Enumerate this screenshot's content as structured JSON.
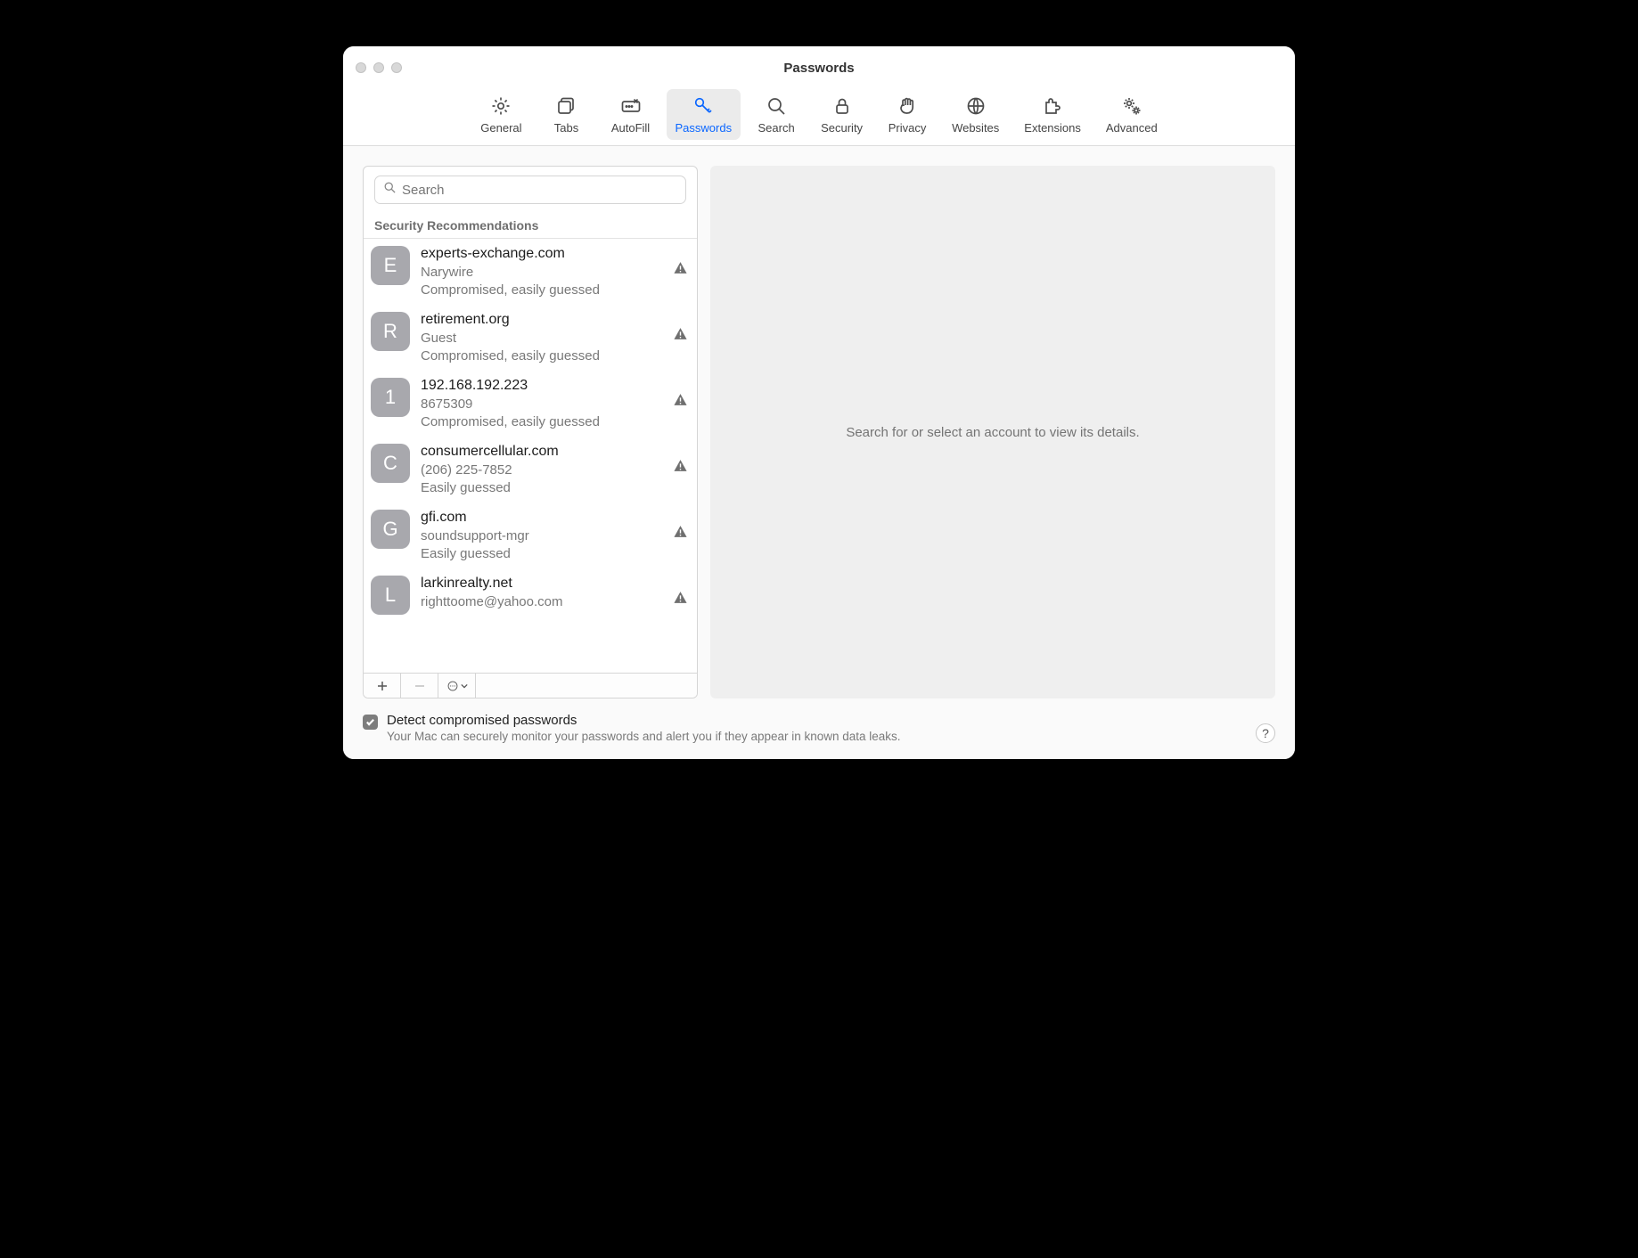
{
  "title": "Passwords",
  "toolbar": [
    {
      "id": "general",
      "label": "General",
      "icon": "gear"
    },
    {
      "id": "tabs",
      "label": "Tabs",
      "icon": "tabs"
    },
    {
      "id": "autofill",
      "label": "AutoFill",
      "icon": "autofill"
    },
    {
      "id": "passwords",
      "label": "Passwords",
      "icon": "key",
      "active": true
    },
    {
      "id": "search",
      "label": "Search",
      "icon": "search"
    },
    {
      "id": "security",
      "label": "Security",
      "icon": "lock"
    },
    {
      "id": "privacy",
      "label": "Privacy",
      "icon": "hand"
    },
    {
      "id": "websites",
      "label": "Websites",
      "icon": "globe"
    },
    {
      "id": "extensions",
      "label": "Extensions",
      "icon": "puzzle"
    },
    {
      "id": "advanced",
      "label": "Advanced",
      "icon": "gears"
    }
  ],
  "search": {
    "placeholder": "Search"
  },
  "list": {
    "section_header": "Security Recommendations",
    "items": [
      {
        "letter": "E",
        "site": "experts-exchange.com",
        "user": "Narywire",
        "status": "Compromised, easily guessed"
      },
      {
        "letter": "R",
        "site": "retirement.org",
        "user": "Guest",
        "status": "Compromised, easily guessed"
      },
      {
        "letter": "1",
        "site": "192.168.192.223",
        "user": "8675309",
        "status": "Compromised, easily guessed"
      },
      {
        "letter": "C",
        "site": "consumercellular.com",
        "user": "(206) 225-7852",
        "status": "Easily guessed"
      },
      {
        "letter": "G",
        "site": "gfi.com",
        "user": "soundsupport-mgr",
        "status": "Easily guessed"
      },
      {
        "letter": "L",
        "site": "larkinrealty.net",
        "user": "righttoome@yahoo.com",
        "status": ""
      }
    ]
  },
  "detail_placeholder": "Search for or select an account to view its details.",
  "detect": {
    "checked": true,
    "label": "Detect compromised passwords",
    "sub": "Your Mac can securely monitor your passwords and alert you if they appear in known data leaks."
  },
  "help_glyph": "?"
}
